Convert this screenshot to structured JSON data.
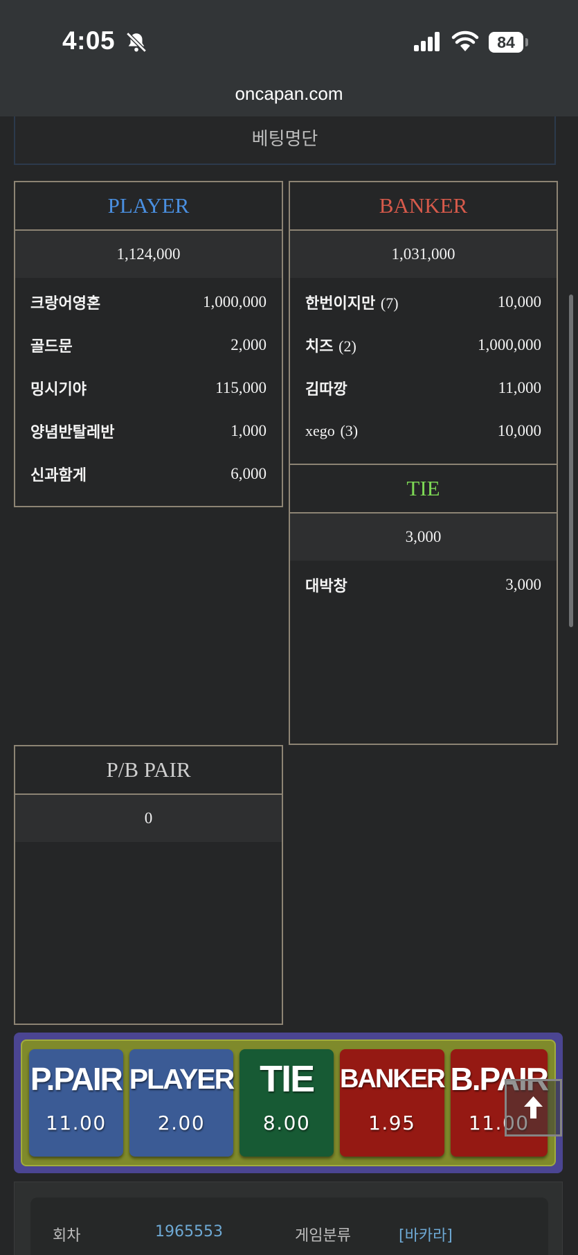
{
  "status_bar": {
    "time": "4:05",
    "battery": "84",
    "url": "oncapan.com"
  },
  "section": {
    "title": "베팅명단"
  },
  "panels": {
    "player": {
      "title": "PLAYER",
      "total": "1,124,000",
      "rows": [
        {
          "name": "크랑어영혼",
          "count": "",
          "amount": "1,000,000"
        },
        {
          "name": "골드문",
          "count": "",
          "amount": "2,000"
        },
        {
          "name": "밍시기야",
          "count": "",
          "amount": "115,000"
        },
        {
          "name": "양념반탈레반",
          "count": "",
          "amount": "1,000"
        },
        {
          "name": "신과함게",
          "count": "",
          "amount": "6,000"
        }
      ]
    },
    "banker": {
      "title": "BANKER",
      "total": "1,031,000",
      "rows": [
        {
          "name": "한번이지만",
          "count": "(7)",
          "amount": "10,000"
        },
        {
          "name": "치즈",
          "count": "(2)",
          "amount": "1,000,000"
        },
        {
          "name": "김따깡",
          "count": "",
          "amount": "11,000"
        },
        {
          "name": "xego",
          "count": "(3)",
          "amount": "10,000"
        }
      ]
    },
    "tie": {
      "title": "TIE",
      "total": "3,000",
      "rows": [
        {
          "name": "대박창",
          "count": "",
          "amount": "3,000"
        }
      ]
    },
    "pair": {
      "title": "P/B PAIR",
      "total": "0",
      "rows": []
    }
  },
  "bet_buttons": [
    {
      "label": "P.PAIR",
      "odds": "11.00",
      "color": "#3b5b95"
    },
    {
      "label": "PLAYER",
      "odds": "2.00",
      "color": "#3b5b95"
    },
    {
      "label": "TIE",
      "odds": "8.00",
      "color": "#175a34"
    },
    {
      "label": "BANKER",
      "odds": "1.95",
      "color": "#951913"
    },
    {
      "label": "B.PAIR",
      "odds": "11.00",
      "color": "#951913"
    }
  ],
  "round_info": {
    "round_label": "회차",
    "round_value": "1965553",
    "game_label": "게임분류",
    "game_value": "[바카라]"
  },
  "colors": {
    "player": "#4a8fe0",
    "banker": "#d75a4b",
    "tie": "#7dd855",
    "panel_border": "#8d8474",
    "bet_frame": "#4b4592",
    "bet_inner": "#7f8a2b"
  },
  "icons": {
    "bell": "bell-slash-icon",
    "signal": "cellular-signal-icon",
    "wifi": "wifi-icon",
    "battery": "battery-icon",
    "scroll_top": "arrow-up-icon"
  }
}
